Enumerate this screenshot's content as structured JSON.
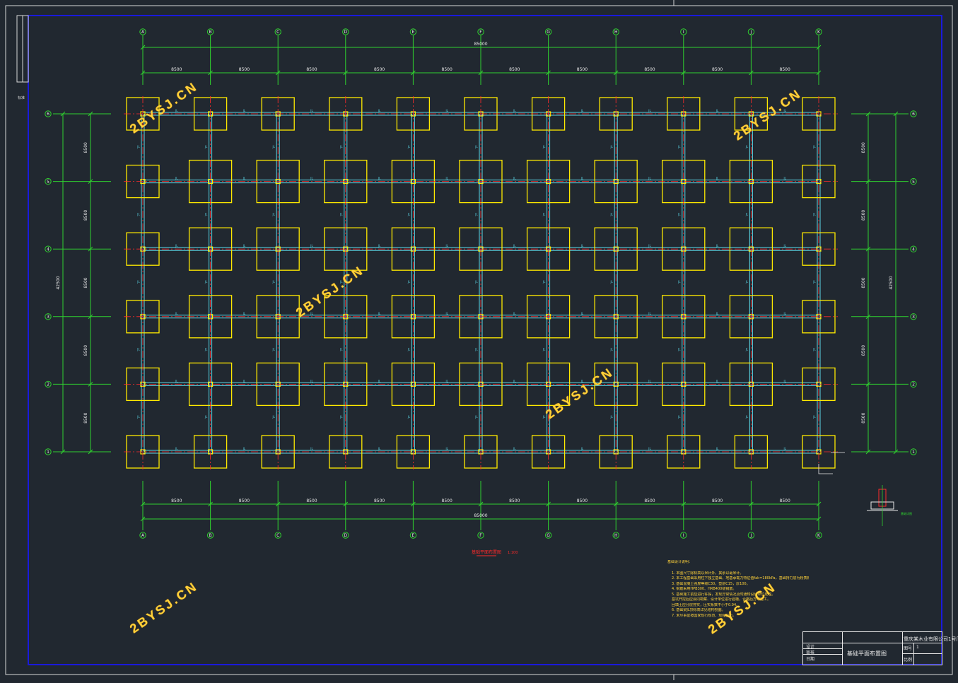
{
  "drawing": {
    "plan_caption": "基础平面布置图",
    "scale_label": "1:100",
    "watermark": "2BYSJ.CN",
    "left_margin_label": "标准",
    "colors": {
      "background": "#212830",
      "axis": "#2fd02f",
      "footing": "#ffea00",
      "beam": "#5bd6e6",
      "center_line": "#ff2a2a",
      "frame": "#1010d0"
    }
  },
  "axes": {
    "columns": [
      "A",
      "B",
      "C",
      "D",
      "E",
      "F",
      "G",
      "H",
      "I",
      "J",
      "K"
    ],
    "rows": [
      "1",
      "2",
      "3",
      "4",
      "5",
      "6"
    ],
    "bay_spacing_x": [
      "8500",
      "8500",
      "8500",
      "8500",
      "8500",
      "8500",
      "8500",
      "8500",
      "8500",
      "8500"
    ],
    "total_x": "85000",
    "bay_spacing_y": [
      "8500",
      "8500",
      "8500",
      "8500",
      "8500"
    ],
    "total_y": "42500"
  },
  "beam_label": "JL",
  "notes": {
    "heading": "基础设计说明：",
    "lines": [
      "1. 本图尺寸除标高以米计外，其余以毫米计。",
      "2. 本工程基础采用柱下独立基础，地基承载力特征值fak=180kPa，基础持力层为粉质粘土层。",
      "3. 基础混凝土强度等级C30，垫层C15，厚100。",
      "4. 钢筋采用HPB300、HRB400级钢筋。",
      "5. 基础施工前应进行钎探，发现异常情况及时通知设计单位处理。",
      "   基坑开挖后应会同勘察、设计单位进行验槽，合格后方可施工。",
      "   回填土应分层夯实，压实系数不小于0.94。",
      "6. 基础梁JL顶标高详见结构剖面。",
      "7. 未尽事宜按国家现行规范、规程执行。"
    ]
  },
  "title_block": {
    "project": "重庆某木业有限公司1号厂房",
    "drawing_name": "基础平面布置图",
    "sheet_label": "图号",
    "scale_label": "比例",
    "sheet_no": "1",
    "drawn": "设计",
    "checked": "审核",
    "date": "日期"
  },
  "detail": {
    "label": "基础详图"
  }
}
